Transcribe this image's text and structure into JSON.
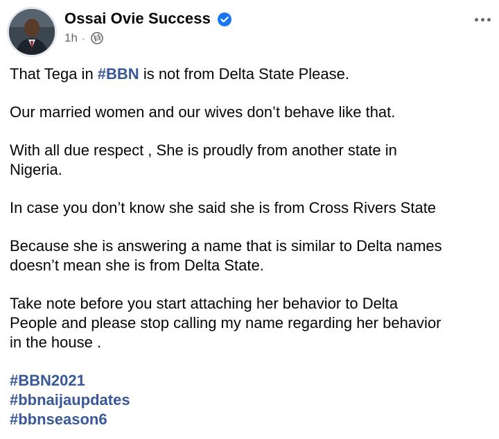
{
  "author": {
    "name": "Ossai Ovie Success",
    "verified": true,
    "icons": {
      "verified": "verified-badge-icon",
      "audience": "globe-icon",
      "more": "more-options-icon"
    }
  },
  "post_meta": {
    "time": "1h",
    "separator": "·"
  },
  "body": {
    "line1_prefix": "That Tega in ",
    "line1_tag": "#BBN",
    "line1_suffix": " is not from Delta State Please.",
    "para2": "Our married women and our wives don’t behave like that.",
    "para3_line1": "With all due respect , She is proudly from another state in",
    "para3_line2": "Nigeria.",
    "para4": "In case you don’t know she said she is from Cross Rivers State",
    "para5_line1": "Because she is answering a name that is similar to Delta names",
    "para5_line2": "doesn’t mean she is from Delta State.",
    "para6_line1": "Take note before you start attaching her behavior to Delta",
    "para6_line2": "People and please stop calling my name regarding her behavior",
    "para6_line3": "in the house ."
  },
  "hashtags": [
    "#BBN2021",
    "#bbnaijaupdates",
    "#bbnseason6"
  ],
  "colors": {
    "text": "#050505",
    "secondary": "#65676b",
    "hashtag": "#385898",
    "verified": "#1877f2"
  }
}
